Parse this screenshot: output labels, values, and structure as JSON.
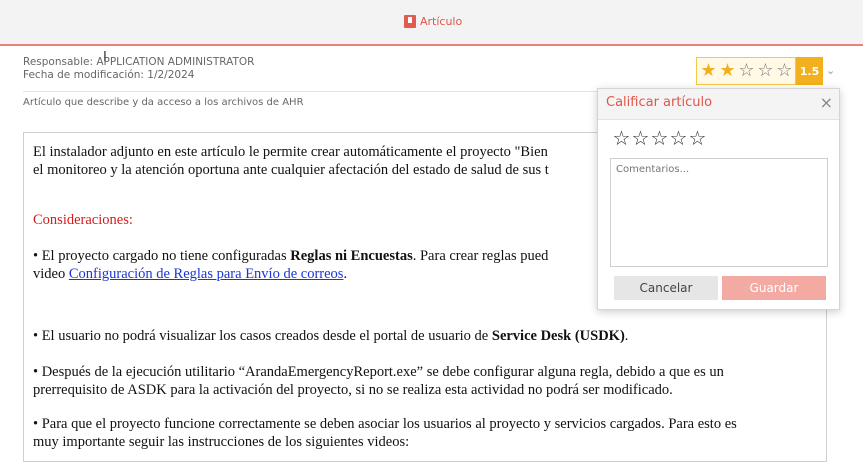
{
  "header": {
    "title": "Artículo",
    "icon": "book-icon",
    "accent": "#e0564a"
  },
  "meta": {
    "responsable": "Responsable: APPLICATION ADMINISTRATOR",
    "fecha": "Fecha de modificación: 1/2/2024",
    "descripcion": "Artículo que describe y da acceso a los archivos de AHR"
  },
  "rating": {
    "value": "1.5",
    "filled": 2,
    "total": 5
  },
  "content": {
    "p1a": "El instalador adjunto en este artículo le permite crear automáticamente el proyecto \"Bien",
    "p1b": "el monitoreo y la atención oportuna ante cualquier afectación del estado de salud de sus t",
    "consideraciones": "Consideraciones:",
    "b1_pre": "• El proyecto cargado no tiene configuradas ",
    "b1_bold": "Reglas ni Encuestas",
    "b1_post": ". Para crear reglas pued",
    "b1_line2_pre": " video ",
    "b1_link": "Configuración de Reglas para Envío de correos",
    "b1_line2_post": ".",
    "b2_pre": "• El usuario no podrá visualizar los casos creados desde el portal de usuario de ",
    "b2_bold": "Service Desk (USDK)",
    "b2_post": ".",
    "b3_line1": "• Después de la ejecución utilitario “ArandaEmergencyReport.exe” se debe configurar alguna regla, debido a que es un",
    "b3_line2": "prerrequisito de ASDK para la activación del proyecto, si no se realiza esta actividad no podrá ser modificado.",
    "b4_line1": "• Para que el proyecto funcione correctamente se deben asociar los usuarios al proyecto y servicios cargados. Para esto es",
    "b4_line2": "muy importante seguir las instrucciones de los siguientes videos:"
  },
  "popup": {
    "title": "Calificar artículo",
    "close": "×",
    "placeholder": "Comentarios...",
    "cancel": "Cancelar",
    "save": "Guardar"
  }
}
